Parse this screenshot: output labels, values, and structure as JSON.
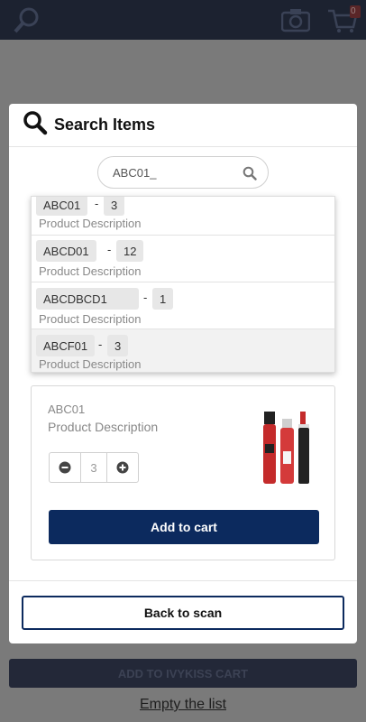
{
  "modal": {
    "title": "Search Items",
    "search": {
      "value": "ABC01_"
    },
    "results": [
      {
        "code": "ABC01",
        "qty": "3",
        "description": "Product Description"
      },
      {
        "code": "ABCD01",
        "qty": "12",
        "description": "Product Description"
      },
      {
        "code": "ABCDBCD1",
        "qty": "1",
        "description": "Product Description"
      },
      {
        "code": "ABCF01",
        "qty": "3",
        "description": "Product Description"
      }
    ],
    "selected": {
      "code": "ABC01",
      "description": "Product Description",
      "quantity": "3",
      "add_label": "Add to cart"
    },
    "back_label": "Back to scan"
  },
  "background": {
    "cart_badge": "0",
    "add_all_label": "ADD TO IVYKISS CART",
    "empty_label": "Empty the list"
  },
  "colors": {
    "primary": "#0c2a5e",
    "topbar": "#1c2230"
  },
  "icons": [
    "search-icon",
    "camera-icon",
    "cart-icon",
    "minus-icon",
    "plus-icon"
  ]
}
